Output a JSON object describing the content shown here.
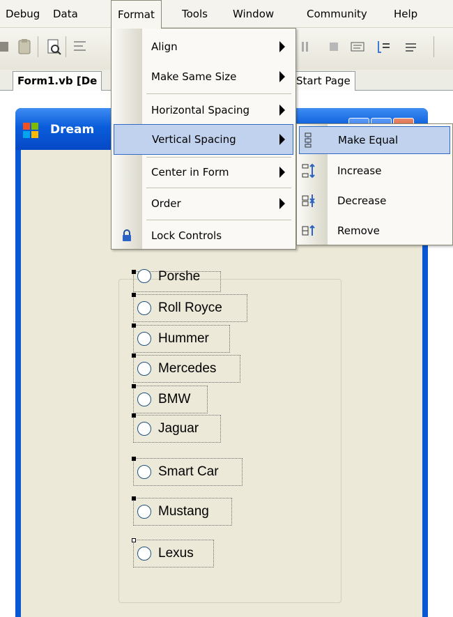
{
  "menubar": {
    "items": [
      "Debug",
      "Data",
      "Format",
      "Tools",
      "Window",
      "Community",
      "Help"
    ]
  },
  "tabs": {
    "designer": "Form1.vb [De",
    "start_page": "Start Page"
  },
  "form": {
    "title": "Dream"
  },
  "radios": [
    "Porshe",
    "Roll Royce",
    "Hummer",
    "Mercedes",
    "BMW",
    "Jaguar",
    "Smart Car",
    "Mustang",
    "Lexus"
  ],
  "format_menu": {
    "items": [
      {
        "label": "Align",
        "submenu": true
      },
      {
        "label": "Make Same Size",
        "submenu": true
      },
      {
        "label": "Horizontal Spacing",
        "submenu": true
      },
      {
        "label": "Vertical Spacing",
        "submenu": true
      },
      {
        "label": "Center in Form",
        "submenu": true
      },
      {
        "label": "Order",
        "submenu": true
      },
      {
        "label": "Lock Controls",
        "submenu": false
      }
    ]
  },
  "vertical_spacing_menu": {
    "items": [
      {
        "label": "Make Equal",
        "icon": "make-equal-icon"
      },
      {
        "label": "Increase",
        "icon": "increase-spacing-icon"
      },
      {
        "label": "Decrease",
        "icon": "decrease-spacing-icon"
      },
      {
        "label": "Remove",
        "icon": "remove-spacing-icon"
      }
    ]
  },
  "colors": {
    "menu_hover": "#c1d2ee",
    "menu_hover_border": "#316ac5",
    "title_bar": "#0a5ddb",
    "form_client": "#ece9d8"
  }
}
